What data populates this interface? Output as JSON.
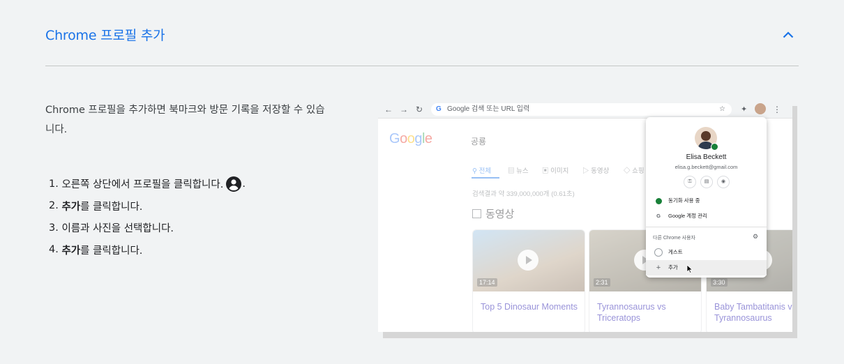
{
  "section": {
    "title": "Chrome 프로필 추가",
    "intro": "Chrome 프로필을 추가하면 북마크와 방문 기록을 저장할 수 있습니다.",
    "steps": [
      {
        "num": "1.",
        "before": "오른쪽 상단에서 프로필을 클릭합니다.",
        "bold": "",
        "after": ""
      },
      {
        "num": "2.",
        "before": "",
        "bold": "추가",
        "after": "를 클릭합니다."
      },
      {
        "num": "3.",
        "before": "이름과 사진을 선택합니다.",
        "bold": "",
        "after": ""
      },
      {
        "num": "4.",
        "before": "",
        "bold": "추가",
        "after": "를 클릭합니다."
      }
    ],
    "step1_suffix": ".",
    "colors": {
      "accent": "#1a73e8",
      "background": "#f1f3f4"
    }
  },
  "screenshot": {
    "omnibox_placeholder": "Google 검색 또는 URL 입력",
    "omnibox_g": "G",
    "google_logo": [
      "G",
      "o",
      "o",
      "g",
      "l",
      "e"
    ],
    "search_query": "공룡",
    "tabs": [
      "전체",
      "뉴스",
      "이미지",
      "동영상",
      "쇼핑"
    ],
    "results_count": "검색결과 약 339,000,000개 (0.61초)",
    "videos_heading": "동영상",
    "videos": [
      {
        "duration": "17:14",
        "title": "Top 5 Dinosaur Moments"
      },
      {
        "duration": "2:31",
        "title": "Tyrannosaurus vs Triceratops"
      },
      {
        "duration": "3:30",
        "title": "Baby Tambatitanis vs Tyrannosaurus"
      }
    ],
    "profile_menu": {
      "name": "Elisa Beckett",
      "email": "elisa.g.beckett@gmail.com",
      "chips": [
        "key-icon",
        "card-icon",
        "location-icon"
      ],
      "sync_label": "동기화 사용 중",
      "manage_label": "Google 계정 관리",
      "other_users_label": "다른 Chrome 사용자",
      "guest_label": "게스트",
      "add_label": "추가"
    }
  }
}
